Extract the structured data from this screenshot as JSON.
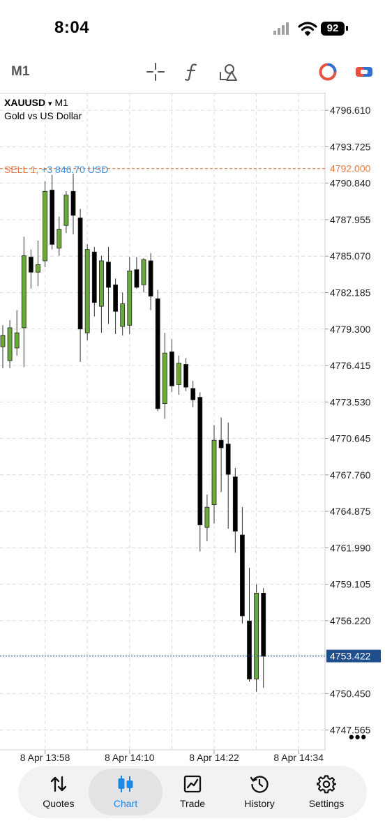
{
  "status_bar": {
    "time": "8:04",
    "battery": "92"
  },
  "toolbar": {
    "timeframe": "M1",
    "icons": [
      "crosshair-icon",
      "indicators-icon",
      "objects-icon",
      "trade-ring-icon",
      "toggle-icon"
    ]
  },
  "chart": {
    "symbol": "XAUUSD",
    "dropdown_glyph": "▾",
    "timeframe": "M1",
    "description": "Gold vs US Dollar",
    "sell_label": "SELL 1,",
    "sell_pnl": "+3 846.70 USD",
    "sell_price": "4792.000",
    "current_price": "4753.422",
    "price_levels": [
      "4796.610",
      "4793.725",
      "4790.840",
      "4787.955",
      "4785.070",
      "4782.185",
      "4779.300",
      "4776.415",
      "4773.530",
      "4770.645",
      "4767.760",
      "4764.875",
      "4761.990",
      "4759.105",
      "4756.220",
      "4750.450",
      "4747.565"
    ],
    "time_labels": [
      "8 Apr 13:58",
      "8 Apr 14:10",
      "8 Apr 14:22",
      "8 Apr 14:34"
    ],
    "more_glyph": "•••",
    "colors": {
      "bull": "#6aaa3a",
      "bear": "#000000",
      "sell_line": "#e07a45",
      "current_line": "#1f4e8c",
      "pnl": "#3a8fd6"
    }
  },
  "chart_data": {
    "type": "candlestick",
    "title": "XAUUSD",
    "subtitle": "Gold vs US Dollar",
    "timeframe": "M1",
    "x_start": "8 Apr 13:52",
    "x_ticks": [
      "8 Apr 13:58",
      "8 Apr 14:10",
      "8 Apr 14:22",
      "8 Apr 14:34"
    ],
    "ylim": [
      4746.0,
      4798.0
    ],
    "grid": true,
    "horizontal_lines": [
      {
        "label": "SELL 1, +3 846.70 USD",
        "value": 4792.0
      },
      {
        "label": "current",
        "value": 4753.422
      }
    ],
    "candles": [
      {
        "o": 4777.9,
        "h": 4779.6,
        "l": 4776.2,
        "c": 4778.8
      },
      {
        "o": 4776.8,
        "h": 4780.0,
        "l": 4776.2,
        "c": 4779.4
      },
      {
        "o": 4777.8,
        "h": 4780.8,
        "l": 4777.2,
        "c": 4779.0
      },
      {
        "o": 4779.4,
        "h": 4786.6,
        "l": 4776.3,
        "c": 4785.1
      },
      {
        "o": 4785.0,
        "h": 4785.6,
        "l": 4782.5,
        "c": 4783.8
      },
      {
        "o": 4783.8,
        "h": 4786.3,
        "l": 4782.7,
        "c": 4784.4
      },
      {
        "o": 4784.7,
        "h": 4791.0,
        "l": 4784.2,
        "c": 4790.2
      },
      {
        "o": 4790.3,
        "h": 4791.5,
        "l": 4785.6,
        "c": 4786.0
      },
      {
        "o": 4785.7,
        "h": 4788.2,
        "l": 4785.1,
        "c": 4787.2
      },
      {
        "o": 4787.5,
        "h": 4790.2,
        "l": 4786.9,
        "c": 4789.9
      },
      {
        "o": 4790.2,
        "h": 4791.6,
        "l": 4786.8,
        "c": 4788.3
      },
      {
        "o": 4788.1,
        "h": 4788.8,
        "l": 4776.7,
        "c": 4779.3
      },
      {
        "o": 4779.0,
        "h": 4786.0,
        "l": 4778.4,
        "c": 4785.6
      },
      {
        "o": 4785.4,
        "h": 4785.8,
        "l": 4780.3,
        "c": 4781.4
      },
      {
        "o": 4781.1,
        "h": 4785.1,
        "l": 4779.0,
        "c": 4784.7
      },
      {
        "o": 4784.6,
        "h": 4785.8,
        "l": 4779.7,
        "c": 4782.6
      },
      {
        "o": 4782.8,
        "h": 4783.3,
        "l": 4778.9,
        "c": 4780.7
      },
      {
        "o": 4779.5,
        "h": 4782.2,
        "l": 4778.8,
        "c": 4781.3
      },
      {
        "o": 4779.6,
        "h": 4785.0,
        "l": 4778.9,
        "c": 4783.9
      },
      {
        "o": 4784.0,
        "h": 4785.0,
        "l": 4782.5,
        "c": 4782.6
      },
      {
        "o": 4782.8,
        "h": 4784.9,
        "l": 4782.2,
        "c": 4784.8
      },
      {
        "o": 4784.7,
        "h": 4785.3,
        "l": 4780.8,
        "c": 4781.9
      },
      {
        "o": 4781.7,
        "h": 4782.4,
        "l": 4772.8,
        "c": 4773.0
      },
      {
        "o": 4773.4,
        "h": 4779.0,
        "l": 4772.2,
        "c": 4777.4
      },
      {
        "o": 4777.5,
        "h": 4778.5,
        "l": 4774.3,
        "c": 4774.8
      },
      {
        "o": 4774.9,
        "h": 4777.2,
        "l": 4774.1,
        "c": 4776.6
      },
      {
        "o": 4776.5,
        "h": 4777.0,
        "l": 4774.4,
        "c": 4774.7
      },
      {
        "o": 4774.6,
        "h": 4775.2,
        "l": 4773.1,
        "c": 4773.7
      },
      {
        "o": 4773.9,
        "h": 4774.3,
        "l": 4761.7,
        "c": 4763.8
      },
      {
        "o": 4763.6,
        "h": 4766.2,
        "l": 4762.5,
        "c": 4765.2
      },
      {
        "o": 4765.4,
        "h": 4771.7,
        "l": 4763.9,
        "c": 4770.5
      },
      {
        "o": 4770.5,
        "h": 4772.3,
        "l": 4766.4,
        "c": 4769.9
      },
      {
        "o": 4770.2,
        "h": 4771.9,
        "l": 4763.5,
        "c": 4767.8
      },
      {
        "o": 4767.6,
        "h": 4768.3,
        "l": 4761.6,
        "c": 4763.3
      },
      {
        "o": 4763.0,
        "h": 4765.2,
        "l": 4756.0,
        "c": 4756.6
      },
      {
        "o": 4756.2,
        "h": 4760.4,
        "l": 4751.4,
        "c": 4751.6
      },
      {
        "o": 4751.6,
        "h": 4759.1,
        "l": 4750.6,
        "c": 4758.4
      },
      {
        "o": 4758.4,
        "h": 4758.8,
        "l": 4750.9,
        "c": 4753.4
      }
    ]
  },
  "bottom_nav": {
    "active": "chart",
    "items": [
      {
        "id": "quotes",
        "label": "Quotes",
        "icon": "quotes-arrows-icon"
      },
      {
        "id": "chart",
        "label": "Chart",
        "icon": "candlestick-icon"
      },
      {
        "id": "trade",
        "label": "Trade",
        "icon": "trade-line-chart-icon"
      },
      {
        "id": "history",
        "label": "History",
        "icon": "history-clock-icon"
      },
      {
        "id": "settings",
        "label": "Settings",
        "icon": "settings-gear-icon"
      }
    ]
  }
}
